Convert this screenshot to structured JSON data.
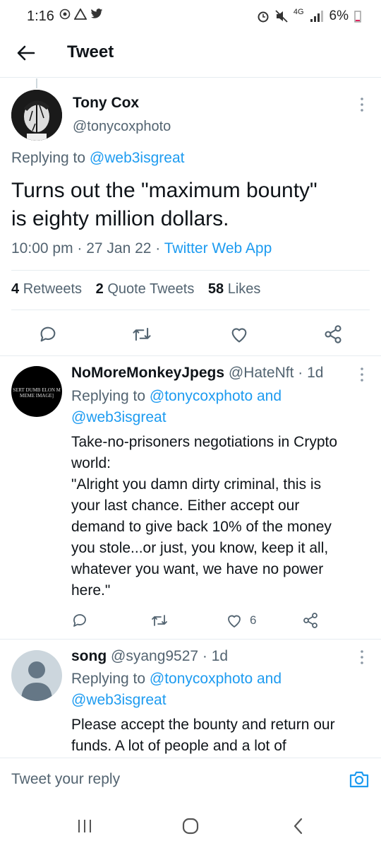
{
  "status": {
    "time": "1:16",
    "network": "4G",
    "battery": "6%"
  },
  "header": {
    "title": "Tweet"
  },
  "main_tweet": {
    "name": "Tony Cox",
    "handle": "@tonycoxphoto",
    "replying_prefix": "Replying to ",
    "replying_to": "@web3isgreat",
    "text_line1": "Turns out the \"maximum bounty\"",
    "text_line2": "is eighty million dollars.",
    "time": "10:00 pm · 27 Jan 22 · ",
    "source": "Twitter Web App",
    "stats": {
      "retweets_count": "4",
      "retweets_label": "Retweets",
      "quotes_count": "2",
      "quotes_label": "Quote Tweets",
      "likes_count": "58",
      "likes_label": "Likes"
    }
  },
  "replies": [
    {
      "name": "NoMoreMonkeyJpegs",
      "handle": "@HateNft",
      "age": " · 1d",
      "avatar_text_1": "SERT DUMB ELON M",
      "avatar_text_2": "MEME IMAGE]",
      "replying_prefix": "Replying to ",
      "replying_to_1": "@tonycoxphoto",
      "replying_and": " and",
      "replying_to_2": "@web3isgreat",
      "lines": [
        "Take-no-prisoners negotiations in Crypto",
        "world:",
        "\"Alright you damn dirty criminal, this is",
        "your last chance. Either accept our",
        "demand to give back 10% of the money",
        "you stole...or just, you know, keep it all,",
        "whatever you want, we have no power",
        "here.\""
      ],
      "likes": "6"
    },
    {
      "name": "song",
      "handle": "@syang9527",
      "age": " · 1d",
      "replying_prefix": "Replying to ",
      "replying_to_1": "@tonycoxphoto",
      "replying_and": " and",
      "replying_to_2": "@web3isgreat",
      "lines": [
        "Please accept the bounty and return our",
        "funds. A lot of people and a lot of"
      ]
    }
  ],
  "reply_bar": {
    "placeholder": "Tweet your reply"
  },
  "colors": {
    "accent": "#1d9bf0",
    "text": "#0f1419",
    "muted": "#536471",
    "divider": "#e6ecf0"
  }
}
